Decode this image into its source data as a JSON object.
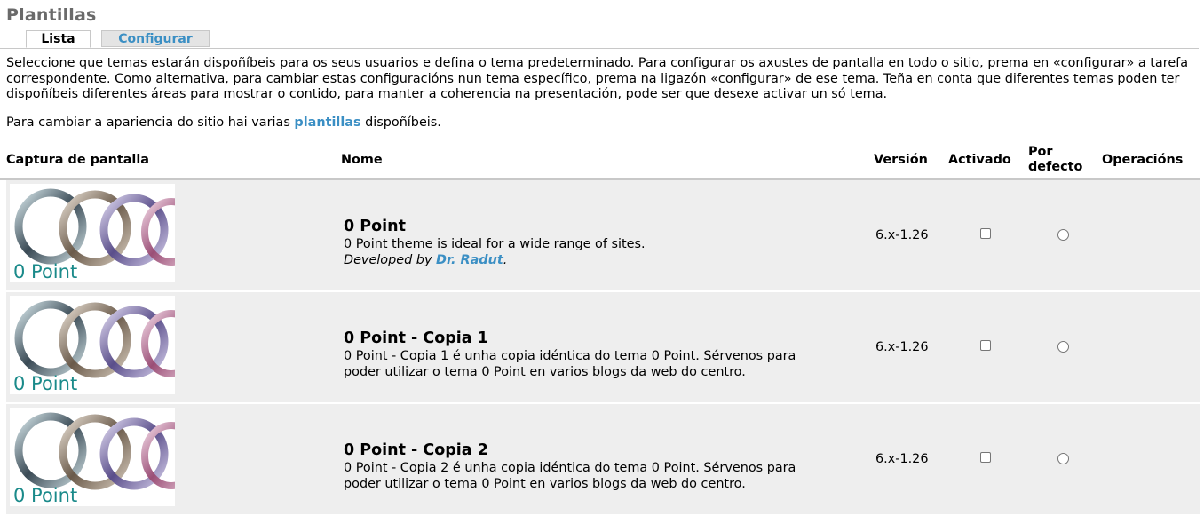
{
  "page": {
    "title": "Plantillas"
  },
  "tabs": [
    {
      "label": "Lista",
      "active": true
    },
    {
      "label": "Configurar",
      "active": false
    }
  ],
  "description": {
    "paragraph1": "Seleccione que temas estarán dispoñíbeis para os seus usuarios e defina o tema predeterminado. Para configurar os axustes de pantalla en todo o sitio, prema en «configurar» a tarefa correspondente. Como alternativa, para cambiar estas configuracións nun tema específico, prema na ligazón «configurar» de ese tema. Teña en conta que diferentes temas poden ter dispoñíbeis diferentes áreas para mostrar o contido, para manter a coherencia na presentación, pode ser que desexe activar un só tema.",
    "paragraph2_before": "Para cambiar a apariencia do sitio hai varias ",
    "paragraph2_link": "plantillas",
    "paragraph2_after": " dispoñíbeis."
  },
  "table": {
    "headers": {
      "screenshot": "Captura de pantalla",
      "name": "Nome",
      "version": "Versión",
      "enabled": "Activado",
      "default": "Por defecto",
      "operations": "Operacións"
    },
    "rows": [
      {
        "screenshot_caption": "0 Point",
        "name": "0 Point",
        "description": "0 Point theme is ideal for a wide range of sites.",
        "developed_by_prefix": "Developed by ",
        "developer": "Dr. Radut",
        "developed_by_suffix": ".",
        "version": "6.x-1.26",
        "enabled": false,
        "default": false
      },
      {
        "screenshot_caption": "0 Point",
        "name": "0 Point - Copia 1",
        "description": "0 Point - Copia 1 é unha copia idéntica do tema 0 Point. Sérvenos para poder utilizar o tema 0 Point en varios blogs da web do centro.",
        "version": "6.x-1.26",
        "enabled": false,
        "default": false
      },
      {
        "screenshot_caption": "0 Point",
        "name": "0 Point - Copia 2",
        "description": "0 Point - Copia 2 é unha copia idéntica do tema 0 Point. Sérvenos para poder utilizar o tema 0 Point en varios blogs da web do centro.",
        "version": "6.x-1.26",
        "enabled": false,
        "default": false
      }
    ]
  },
  "colors": {
    "link": "#3b8fc4",
    "title": "#6a6a6a",
    "row_background": "#eeeeee",
    "caption": "#1a8a8a"
  }
}
